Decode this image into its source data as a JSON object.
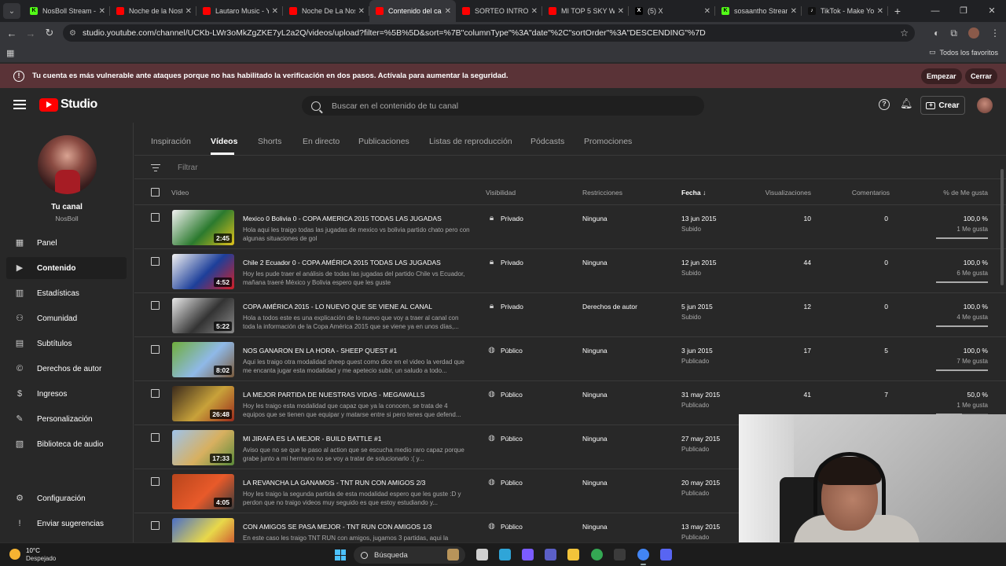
{
  "browser": {
    "tabs": [
      {
        "title": "NosBoll Stream - ",
        "color": "#53fc18",
        "glyph": "K",
        "active": false
      },
      {
        "title": "Noche de la Nost",
        "color": "#ff0000",
        "glyph": "",
        "active": false
      },
      {
        "title": "Lautaro Music - Y",
        "color": "#ff0000",
        "glyph": "",
        "active": false
      },
      {
        "title": "Noche De La Nos",
        "color": "#ff0000",
        "glyph": "",
        "active": false
      },
      {
        "title": "Contenido del can",
        "color": "#ff0000",
        "glyph": "",
        "active": true
      },
      {
        "title": "SORTEO INTRO #",
        "color": "#ff0000",
        "glyph": "",
        "active": false
      },
      {
        "title": "MI TOP 5 SKY WA",
        "color": "#ff0000",
        "glyph": "",
        "active": false
      },
      {
        "title": "(5) X",
        "color": "#000000",
        "glyph": "X",
        "active": false
      },
      {
        "title": "sosaantho Stream",
        "color": "#53fc18",
        "glyph": "K",
        "active": false
      },
      {
        "title": "TikTok - Make You",
        "color": "#111111",
        "glyph": "♪",
        "active": false
      }
    ],
    "url": "studio.youtube.com/channel/UCKb-LWr3oMkZgZKE7yL2a2Q/videos/upload?filter=%5B%5D&sort=%7B\"columnType\"%3A\"date\"%2C\"sortOrder\"%3A\"DESCENDING\"%7D",
    "bookmarks_label": "Todos los favoritos"
  },
  "banner": {
    "message": "Tu cuenta es más vulnerable ante ataques porque no has habilitado la verificación en dos pasos. Actívala para aumentar la seguridad.",
    "start_label": "Empezar",
    "close_label": "Cerrar"
  },
  "header": {
    "logo_text": "Studio",
    "search_placeholder": "Buscar en el contenido de tu canal",
    "create_label": "Crear"
  },
  "sidebar": {
    "channel_title": "Tu canal",
    "channel_handle": "NosBoll",
    "items": [
      {
        "label": "Panel",
        "icon": "▦",
        "active": false
      },
      {
        "label": "Contenido",
        "icon": "▶",
        "active": true
      },
      {
        "label": "Estadísticas",
        "icon": "▥",
        "active": false
      },
      {
        "label": "Comunidad",
        "icon": "⚇",
        "active": false
      },
      {
        "label": "Subtítulos",
        "icon": "▤",
        "active": false
      },
      {
        "label": "Derechos de autor",
        "icon": "©",
        "active": false
      },
      {
        "label": "Ingresos",
        "icon": "$",
        "active": false
      },
      {
        "label": "Personalización",
        "icon": "✎",
        "active": false
      },
      {
        "label": "Biblioteca de audio",
        "icon": "▧",
        "active": false
      }
    ],
    "bottom_items": [
      {
        "label": "Configuración",
        "icon": "⚙"
      },
      {
        "label": "Enviar sugerencias",
        "icon": "!"
      }
    ]
  },
  "content_tabs": [
    "Inspiración",
    "Vídeos",
    "Shorts",
    "En directo",
    "Publicaciones",
    "Listas de reproducción",
    "Pódcasts",
    "Promociones"
  ],
  "active_tab": "Vídeos",
  "filter_placeholder": "Filtrar",
  "table": {
    "headers": {
      "video": "Vídeo",
      "visibility": "Visibilidad",
      "restrictions": "Restricciones",
      "date": "Fecha",
      "views": "Visualizaciones",
      "comments": "Comentarios",
      "likes": "% de Me gusta"
    },
    "rows": [
      {
        "title": "Mexico 0 Bolivia 0 - COPA AMERICA 2015 TODAS LAS JUGADAS",
        "description": "Hola aqui les traigo todas las jugadas de mexico vs bolivia partido chato pero con algunas situaciones de gol",
        "duration": "2:45",
        "visibility": "Privado",
        "visibility_icon": "lock-icon",
        "restrictions": "Ninguna",
        "date": "13 jun 2015",
        "date_status": "Subido",
        "views": "10",
        "comments": "0",
        "likes_pct": "100,0 %",
        "likes_count": "1 Me gusta",
        "likes_fraction": 1.0,
        "thumb_colors": [
          "#f2f2f2",
          "#2b7a2e",
          "#e0c21c"
        ]
      },
      {
        "title": "Chile 2 Ecuador 0 - COPA AMÉRICA 2015 TODAS LAS JUGADAS",
        "description": "Hoy les pude traer el análisis de todas las jugadas del partido Chile vs Ecuador, mañana traeré México y Bolivia espero que les guste",
        "duration": "4:52",
        "visibility": "Privado",
        "visibility_icon": "lock-icon",
        "restrictions": "Ninguna",
        "date": "12 jun 2015",
        "date_status": "Subido",
        "views": "44",
        "comments": "0",
        "likes_pct": "100,0 %",
        "likes_count": "6 Me gusta",
        "likes_fraction": 1.0,
        "thumb_colors": [
          "#f2f2f2",
          "#1d3f9a",
          "#d41f26"
        ]
      },
      {
        "title": "COPA AMÉRICA 2015 - LO NUEVO QUE SE VIENE AL CANAL",
        "description": "Hola a todos este es una explicación de lo nuevo que voy a traer al canal con toda la información de la Copa América 2015 que se viene ya en unos días,...",
        "duration": "5:22",
        "visibility": "Privado",
        "visibility_icon": "lock-icon",
        "restrictions": "Derechos de autor",
        "date": "5 jun 2015",
        "date_status": "Subido",
        "views": "12",
        "comments": "0",
        "likes_pct": "100,0 %",
        "likes_count": "4 Me gusta",
        "likes_fraction": 1.0,
        "thumb_colors": [
          "#e8e8e8",
          "#333333",
          "#8a8a8a"
        ]
      },
      {
        "title": "NOS GANARON EN LA HORA - SHEEP QUEST #1",
        "description": "Aqui les traigo otra modalidad sheep quest como dice en el video la verdad que me encanta jugar esta modalidad y me apetecio subir, un saludo a todo...",
        "duration": "8:02",
        "visibility": "Público",
        "visibility_icon": "globe-icon",
        "restrictions": "Ninguna",
        "date": "3 jun 2015",
        "date_status": "Publicado",
        "views": "17",
        "comments": "5",
        "likes_pct": "100,0 %",
        "likes_count": "7 Me gusta",
        "likes_fraction": 1.0,
        "thumb_colors": [
          "#6fae3a",
          "#8fb9e8",
          "#7a5a3a"
        ]
      },
      {
        "title": "LA MEJOR PARTIDA DE NUESTRAS VIDAS - MEGAWALLS",
        "description": "Hoy les traigo esta modalidad que capaz que ya la conocen, se trata de 4 equipos que se tienen que equipar y matarse entre si pero tenes que defend...",
        "duration": "26:48",
        "visibility": "Público",
        "visibility_icon": "globe-icon",
        "restrictions": "Ninguna",
        "date": "31 may 2015",
        "date_status": "Publicado",
        "views": "41",
        "comments": "7",
        "likes_pct": "50,0 %",
        "likes_count": "1 Me gusta",
        "likes_fraction": 0.5,
        "thumb_colors": [
          "#3a2a1c",
          "#c8a23a",
          "#9a2a1c"
        ]
      },
      {
        "title": "MI JIRAFA ES LA MEJOR - BUILD BATTLE #1",
        "description": "Aviso que no se que le paso al action que se escucha medio raro capaz porque grabe junto a mi hermano no se voy a tratar de solucionarlo :( y...",
        "duration": "17:33",
        "visibility": "Público",
        "visibility_icon": "globe-icon",
        "restrictions": "Ninguna",
        "date": "27 may 2015",
        "date_status": "Publicado",
        "views": "",
        "comments": "",
        "likes_pct": "",
        "likes_count": "",
        "likes_fraction": null,
        "thumb_colors": [
          "#9ec3ea",
          "#d8b060",
          "#5a8a3a"
        ]
      },
      {
        "title": "LA REVANCHA LA GANAMOS - TNT RUN CON AMIGOS 2/3",
        "description": "Hoy les traigo la segunda partida de esta modalidad espero que les guste :D y perdon que no traigo videos muy seguido es que estoy estudiando y...",
        "duration": "4:05",
        "visibility": "Público",
        "visibility_icon": "globe-icon",
        "restrictions": "Ninguna",
        "date": "20 may 2015",
        "date_status": "Publicado",
        "views": "",
        "comments": "",
        "likes_pct": "",
        "likes_count": "",
        "likes_fraction": null,
        "thumb_colors": [
          "#b8451c",
          "#e85a2a",
          "#3a3a3a"
        ]
      },
      {
        "title": "CON AMIGOS SE PASA MEJOR - TNT RUN CON AMIGOS 1/3",
        "description": "En este caso les traigo TNT RUN con amigos, jugamos 3 partidas, aqui la",
        "duration": "",
        "visibility": "Público",
        "visibility_icon": "globe-icon",
        "restrictions": "Ninguna",
        "date": "13 may 2015",
        "date_status": "Publicado",
        "views": "",
        "comments": "",
        "likes_pct": "",
        "likes_count": "",
        "likes_fraction": null,
        "thumb_colors": [
          "#4a6fc8",
          "#e8d84a",
          "#c83a2a"
        ]
      }
    ]
  },
  "taskbar": {
    "temperature": "10°C",
    "weather": "Despejado",
    "search_label": "Búsqueda",
    "apps": [
      {
        "name": "deer-icon",
        "color": "#b8945a"
      },
      {
        "name": "task-view-icon",
        "color": "#cfcfcf"
      },
      {
        "name": "edge-icon",
        "color": "#2fa5d8"
      },
      {
        "name": "copilot-icon",
        "color": "#7b5cff"
      },
      {
        "name": "teams-icon",
        "color": "#5b5fc7"
      },
      {
        "name": "explorer-icon",
        "color": "#f2c33a"
      },
      {
        "name": "chrome-icon",
        "color": "#34a853"
      },
      {
        "name": "obs-icon",
        "color": "#3b3b3b"
      },
      {
        "name": "chrome-running-icon",
        "color": "#4285f4"
      },
      {
        "name": "discord-icon",
        "color": "#5865f2"
      }
    ]
  }
}
